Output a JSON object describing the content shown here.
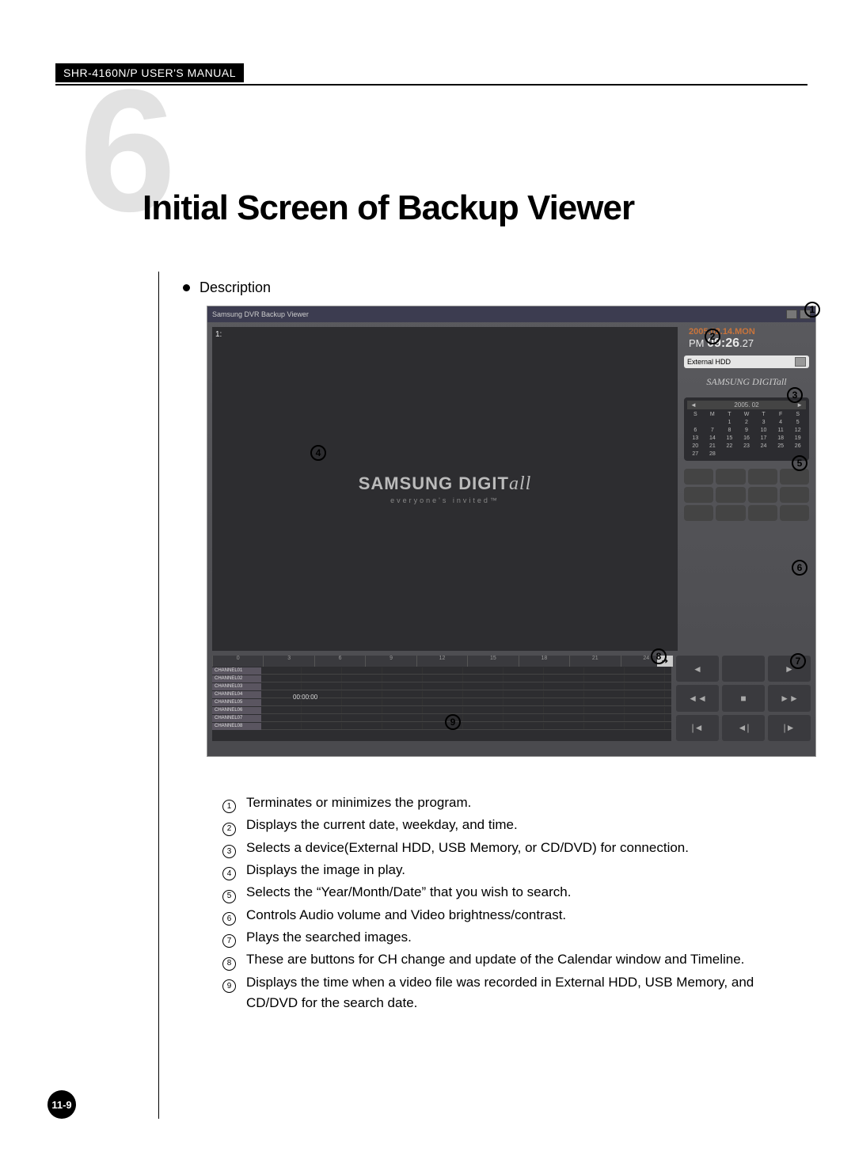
{
  "header": "SHR-4160N/P USER'S MANUAL",
  "chapter_num": "6",
  "chapter_title": "Initial Screen of Backup Viewer",
  "section_label": "Description",
  "page_num": "11-9",
  "screenshot": {
    "window_title": "Samsung DVR Backup Viewer",
    "video_area_num": "1:",
    "logo_main": "SAMSUNG DIGIT",
    "logo_suffix": "all",
    "logo_tag": "everyone's invited™",
    "date_line": "2005.02.14.MON",
    "time_prefix": "PM ",
    "time_main": "09:26",
    "time_sec": ".27",
    "device": "External HDD",
    "brand_side": "SAMSUNG DIGITall",
    "cal_month": "2005. 02",
    "cal_dow": [
      "S",
      "M",
      "T",
      "W",
      "T",
      "F",
      "S"
    ],
    "cal_days": [
      "",
      "",
      "1",
      "2",
      "3",
      "4",
      "5",
      "6",
      "7",
      "8",
      "9",
      "10",
      "11",
      "12",
      "13",
      "14",
      "15",
      "16",
      "17",
      "18",
      "19",
      "20",
      "21",
      "22",
      "23",
      "24",
      "25",
      "26",
      "27",
      "28",
      "",
      "",
      "",
      "",
      ""
    ],
    "ruler": [
      "0",
      "3",
      "6",
      "9",
      "12",
      "15",
      "18",
      "21",
      "24"
    ],
    "timecode": "00:00:00",
    "channels": [
      "CHANNEL01",
      "CHANNEL02",
      "CHANNEL03",
      "CHANNEL04",
      "CHANNEL05",
      "CHANNEL06",
      "CHANNEL07",
      "CHANNEL08"
    ],
    "play_glyphs": [
      "◄",
      "",
      "►",
      "◄◄",
      "■",
      "►►",
      "|◄",
      "◄|",
      "|►",
      "►|"
    ]
  },
  "callouts": {
    "c1": "1",
    "c2": "2",
    "c3": "3",
    "c4": "4",
    "c5": "5",
    "c6": "6",
    "c7": "7",
    "c8": "8",
    "c9": "9"
  },
  "descriptions": [
    {
      "n": "1",
      "t": "Terminates or minimizes the program."
    },
    {
      "n": "2",
      "t": "Displays the current date, weekday, and time."
    },
    {
      "n": "3",
      "t": "Selects a device(External HDD, USB Memory, or CD/DVD) for connection."
    },
    {
      "n": "4",
      "t": "Displays the image in play."
    },
    {
      "n": "5",
      "t": "Selects the “Year/Month/Date” that you wish to search."
    },
    {
      "n": "6",
      "t": "Controls Audio volume and Video brightness/contrast."
    },
    {
      "n": "7",
      "t": "Plays the searched images."
    },
    {
      "n": "8",
      "t": "These are buttons for CH change and update of the Calendar window and Timeline."
    },
    {
      "n": "9",
      "t": "Displays the time when a video file was recorded in External HDD, USB Memory, and CD/DVD for the search date."
    }
  ]
}
